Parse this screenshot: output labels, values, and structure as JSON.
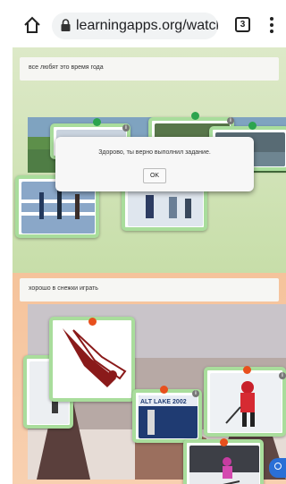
{
  "browser": {
    "url": "learningapps.org/watch",
    "tab_count": "3"
  },
  "dialog": {
    "message": "Здорово, ты верно выполнил задание.",
    "ok_label": "OK"
  },
  "sections": [
    {
      "title": "все любят это время года"
    },
    {
      "title": "хорошо в снежки играть"
    }
  ],
  "image_texts": {
    "salt_lake": "ALT LAKE 2002"
  },
  "colors": {
    "card_border": "#a9dd9c",
    "pin_green": "#2ca44e",
    "pin_red": "#e8501d",
    "top_section_bg": "#c7dea9",
    "bottom_section_bg": "#f8d0b0"
  }
}
